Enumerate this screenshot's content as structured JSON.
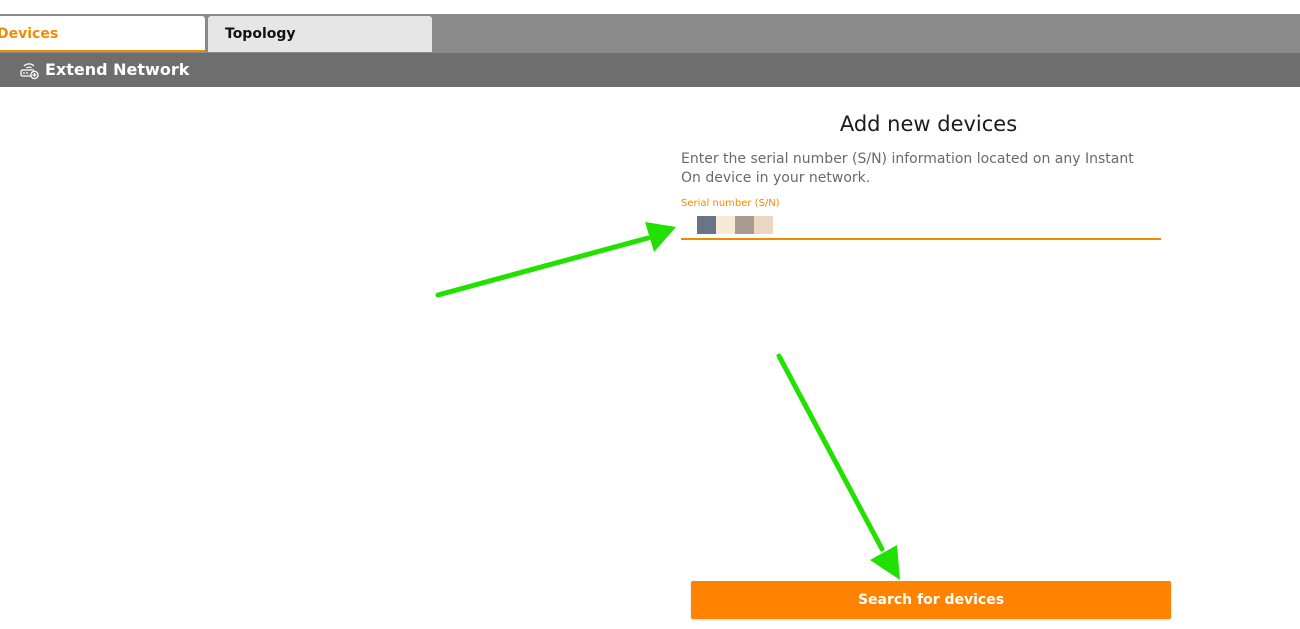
{
  "tabs": {
    "devices_label": "Devices",
    "topology_label": "Topology"
  },
  "header": {
    "title": "Extend Network",
    "icon": "router-add-icon"
  },
  "main": {
    "title": "Add new devices",
    "description": "Enter the serial number (S/N) information located on any Instant On device in your network.",
    "serial_field": {
      "label": "Serial number (S/N)",
      "value": ""
    },
    "search_button_label": "Search for devices"
  },
  "colors": {
    "accent": "#ff8300",
    "annotation_arrow": "#22e000"
  }
}
